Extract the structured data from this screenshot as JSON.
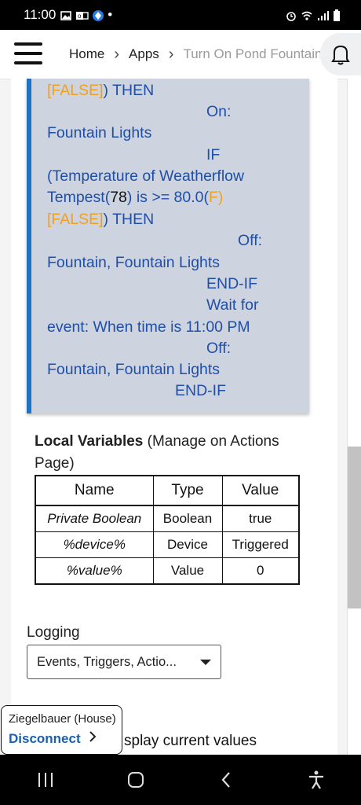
{
  "status_bar": {
    "time": "11:00",
    "dot": "•",
    "icons": [
      "image-icon",
      "outlook-icon",
      "app-icon",
      "alarm-icon",
      "wifi-icon",
      "signal-icon",
      "battery-icon"
    ]
  },
  "header": {
    "breadcrumbs": [
      "Home",
      "Apps",
      "Turn On Pond Fountain"
    ],
    "icons": [
      "menu-icon",
      "chevron-right-icon",
      "bell-icon"
    ]
  },
  "rule": {
    "line1_a": "[FALSE]",
    "line1_b": ") THEN",
    "line2": "On:",
    "line3": "Fountain Lights",
    "line4": "IF",
    "line5": "(Temperature of Weatherflow",
    "line6_a": "Tempest(",
    "line6_b": "78",
    "line6_c": ") is >= 80.0(",
    "line6_d": "F",
    "line6_e": ")",
    "line7_a": "[FALSE]",
    "line7_b": ") THEN",
    "line8": "Off:",
    "line9": "Fountain, Fountain Lights",
    "line10": "END-IF",
    "line11": "Wait for",
    "line12": "event: When time is 11:00 PM",
    "line13": "Off:",
    "line14": "Fountain, Fountain Lights",
    "line15": "END-IF"
  },
  "local_variables": {
    "title": "Local Variables",
    "subtitle": " (Manage on Actions Page)",
    "columns": [
      "Name",
      "Type",
      "Value"
    ],
    "rows": [
      [
        "Private Boolean",
        "Boolean",
        "true"
      ],
      [
        "%device%",
        "Device",
        "Triggered"
      ],
      [
        "%value%",
        "Value",
        "0"
      ]
    ]
  },
  "logging": {
    "label": "Logging",
    "selected": "Events, Triggers, Actio..."
  },
  "display_values_text": "splay current values",
  "hub": {
    "name": "Ziegelbauer (House)",
    "action": "Disconnect"
  },
  "colors": {
    "accent_blue": "#1e72c4",
    "rule_text": "#1f4fa8",
    "false_orange": "#f0a020",
    "rule_bg": "#cdd3df"
  }
}
